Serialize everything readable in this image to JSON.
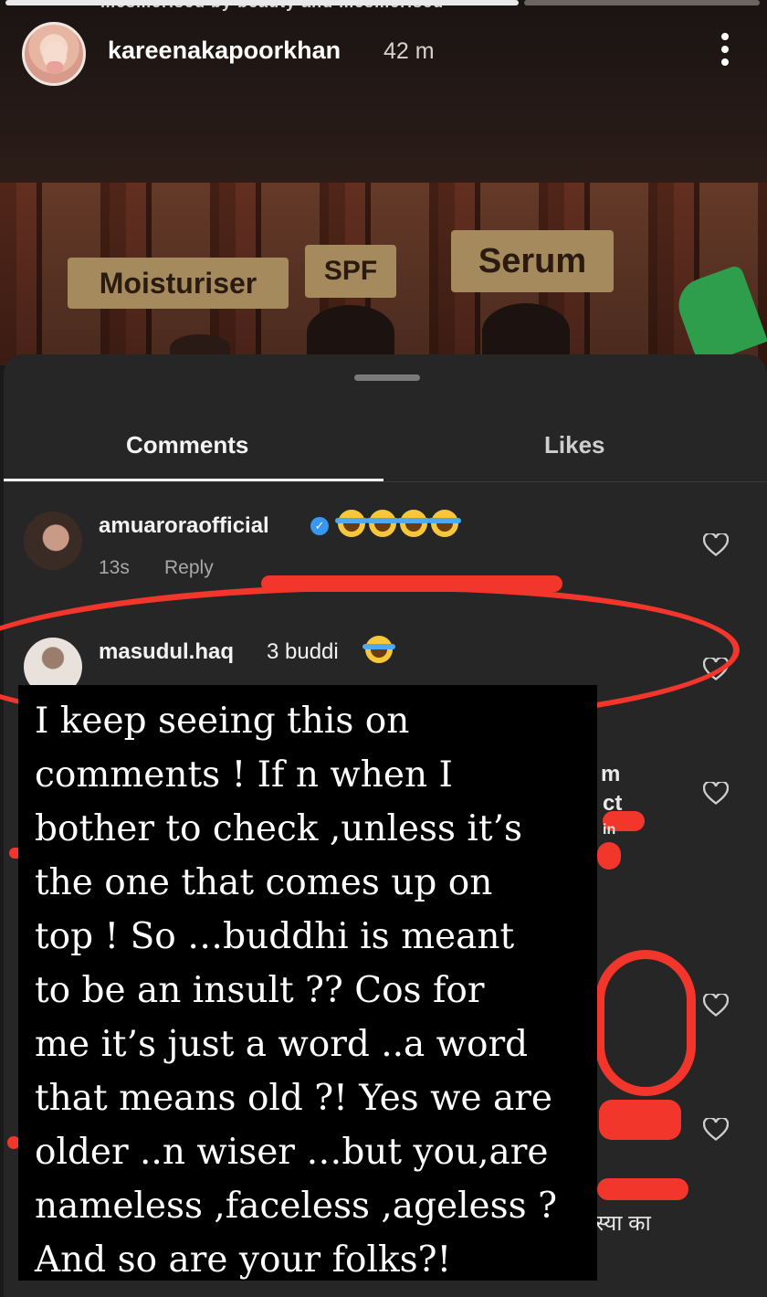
{
  "story": {
    "progress_caption": "mesmerised by beauty and mesmerised",
    "username": "kareenakapoorkhan",
    "time": "42 m",
    "menu_icon": "more-vertical-icon"
  },
  "frame": {
    "tags": [
      "Moisturiser",
      "SPF",
      "Serum"
    ]
  },
  "sheet": {
    "tabs": {
      "comments": "Comments",
      "likes": "Likes"
    },
    "comments": [
      {
        "user": "amuaroraofficial",
        "verified": true,
        "text": "",
        "emoji_count": 4,
        "meta_time": "13s",
        "meta_reply": "Reply"
      },
      {
        "user": "masudul.haq",
        "verified": false,
        "text": "3 buddi",
        "emoji_count": 1
      }
    ],
    "peek_fragments": [
      "m",
      "ct",
      "in"
    ],
    "hindi_fragment": "स्या का"
  },
  "note": {
    "text": "I keep seeing this on\ncomments ! If n when I\nbother to check ,unless it’s\nthe one that comes up on\ntop ! So …buddhi is meant\nto be an insult ?? Cos for\nme it’s just a word ..a word\nthat means old ?! Yes we are\nolder ..n wiser …but you,are\nnameless ,faceless ,ageless ?\nAnd so are your folks?!"
  },
  "colors": {
    "annotation_red": "#f2362b",
    "sheet_bg": "#262626",
    "verified_blue": "#3897f0"
  }
}
